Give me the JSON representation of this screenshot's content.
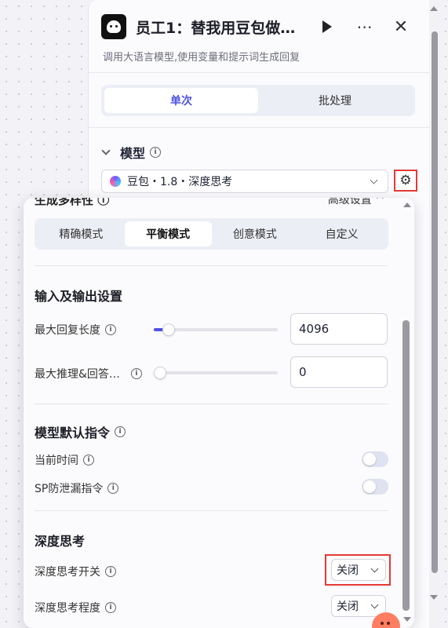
{
  "header": {
    "title": "员工1：替我用豆包做…",
    "subtitle": "调用大语言模型,使用变量和提示词生成回复",
    "more_glyph": "⋯",
    "close_glyph": "✕"
  },
  "run_tabs": [
    {
      "label": "单次",
      "active": true
    },
    {
      "label": "批处理",
      "active": false
    }
  ],
  "model": {
    "section_label": "模型",
    "selected": "豆包・1.8・深度思考",
    "settings_glyph": "⚙"
  },
  "popup": {
    "cut_title": "生成多样性 ⓘ",
    "cut_right": "高级设置 ^",
    "modes": [
      {
        "label": "精确模式",
        "active": false
      },
      {
        "label": "平衡模式",
        "active": true
      },
      {
        "label": "创意模式",
        "active": false
      },
      {
        "label": "自定义",
        "active": false
      }
    ],
    "io_section": {
      "title": "输入及输出设置",
      "max_reply_label": "最大回复长度",
      "max_reply_value": "4096",
      "max_reply_fraction": 0.07,
      "max_reason_label": "最大推理&回答…",
      "max_reason_value": "0",
      "max_reason_fraction": 0.0
    },
    "instr_section": {
      "title": "模型默认指令",
      "current_time_label": "当前时间",
      "current_time_on": false,
      "sp_label": "SP防泄漏指令",
      "sp_on": false
    },
    "think_section": {
      "title": "深度思考",
      "switch_label": "深度思考开关",
      "switch_value": "关闭",
      "level_label": "深度思考程度",
      "level_value": "关闭"
    }
  },
  "colors": {
    "accent": "#4f53e5",
    "highlight_red": "#e53935"
  }
}
